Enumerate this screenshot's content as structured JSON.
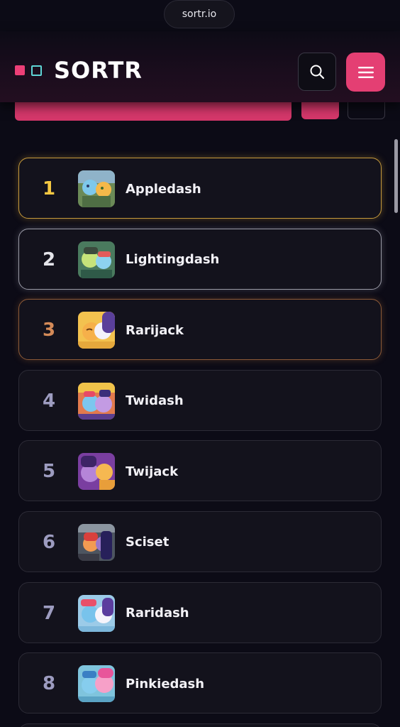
{
  "browser": {
    "url": "sortr.io"
  },
  "header": {
    "logo_text": "SORTR",
    "logo_colors": {
      "pink": "#ec3f77",
      "teal": "#5fd5d6"
    },
    "search_icon": "search-icon",
    "menu_icon": "hamburger-menu-icon",
    "accent_color": "#e43f73"
  },
  "rank_colors": {
    "gold": "#f5c842",
    "silver": "#e4e4ea",
    "bronze": "#d48a58",
    "default": "#9d9cc0"
  },
  "rankings": [
    {
      "rank": "1",
      "name": "Appledash"
    },
    {
      "rank": "2",
      "name": "Lightingdash"
    },
    {
      "rank": "3",
      "name": "Rarijack"
    },
    {
      "rank": "4",
      "name": "Twidash"
    },
    {
      "rank": "5",
      "name": "Twijack"
    },
    {
      "rank": "6",
      "name": "Sciset"
    },
    {
      "rank": "7",
      "name": "Raridash"
    },
    {
      "rank": "8",
      "name": "Pinkiedash"
    }
  ]
}
